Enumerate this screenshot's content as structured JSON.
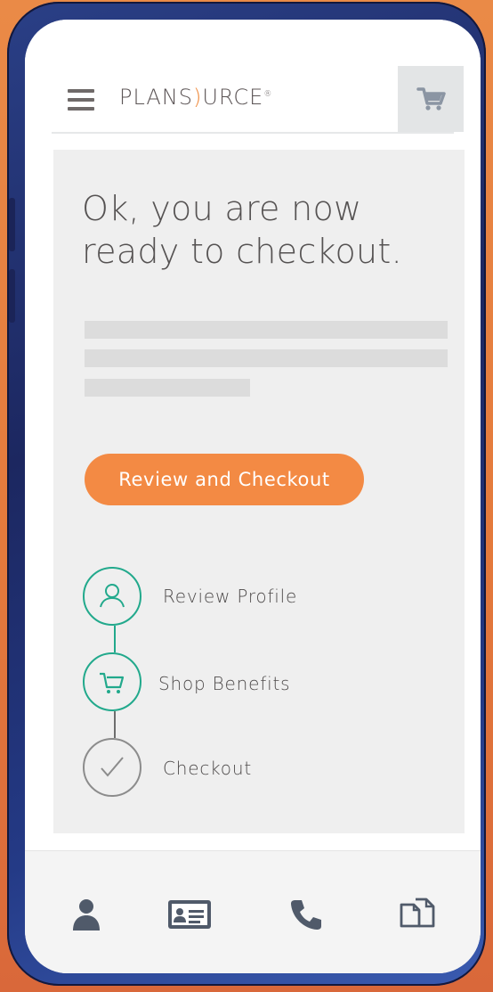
{
  "brand": {
    "logo_text": "PLANSOURCE",
    "accent": "#f38a44",
    "step_color": "#22a98c"
  },
  "header": {
    "menu_icon": "hamburger-icon",
    "cart_icon": "cart-icon"
  },
  "main": {
    "headline": "Ok, you are now ready to checkout.",
    "cta_label": "Review and Checkout"
  },
  "steps": [
    {
      "label": "Review Profile",
      "icon": "user-icon",
      "status": "active"
    },
    {
      "label": "Shop Benefits",
      "icon": "cart-icon",
      "status": "active"
    },
    {
      "label": "Checkout",
      "icon": "checkmark-icon",
      "status": "pending"
    }
  ],
  "tabbar": [
    {
      "icon": "user-icon"
    },
    {
      "icon": "id-card-icon"
    },
    {
      "icon": "phone-icon"
    },
    {
      "icon": "documents-icon"
    }
  ]
}
